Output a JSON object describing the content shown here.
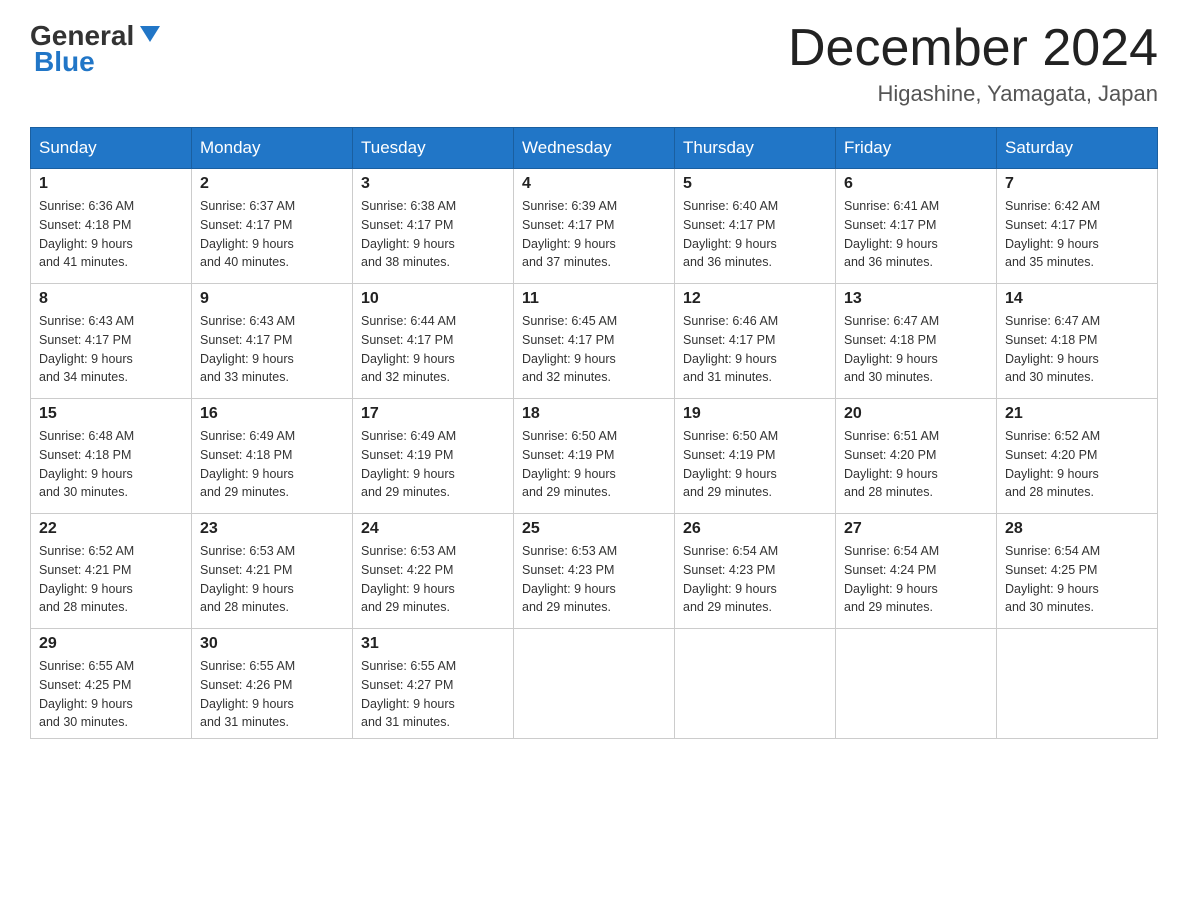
{
  "header": {
    "logo_general": "General",
    "logo_blue": "Blue",
    "month_title": "December 2024",
    "location": "Higashine, Yamagata, Japan"
  },
  "weekdays": [
    "Sunday",
    "Monday",
    "Tuesday",
    "Wednesday",
    "Thursday",
    "Friday",
    "Saturday"
  ],
  "weeks": [
    [
      {
        "day": "1",
        "sunrise": "6:36 AM",
        "sunset": "4:18 PM",
        "daylight": "9 hours and 41 minutes."
      },
      {
        "day": "2",
        "sunrise": "6:37 AM",
        "sunset": "4:17 PM",
        "daylight": "9 hours and 40 minutes."
      },
      {
        "day": "3",
        "sunrise": "6:38 AM",
        "sunset": "4:17 PM",
        "daylight": "9 hours and 38 minutes."
      },
      {
        "day": "4",
        "sunrise": "6:39 AM",
        "sunset": "4:17 PM",
        "daylight": "9 hours and 37 minutes."
      },
      {
        "day": "5",
        "sunrise": "6:40 AM",
        "sunset": "4:17 PM",
        "daylight": "9 hours and 36 minutes."
      },
      {
        "day": "6",
        "sunrise": "6:41 AM",
        "sunset": "4:17 PM",
        "daylight": "9 hours and 36 minutes."
      },
      {
        "day": "7",
        "sunrise": "6:42 AM",
        "sunset": "4:17 PM",
        "daylight": "9 hours and 35 minutes."
      }
    ],
    [
      {
        "day": "8",
        "sunrise": "6:43 AM",
        "sunset": "4:17 PM",
        "daylight": "9 hours and 34 minutes."
      },
      {
        "day": "9",
        "sunrise": "6:43 AM",
        "sunset": "4:17 PM",
        "daylight": "9 hours and 33 minutes."
      },
      {
        "day": "10",
        "sunrise": "6:44 AM",
        "sunset": "4:17 PM",
        "daylight": "9 hours and 32 minutes."
      },
      {
        "day": "11",
        "sunrise": "6:45 AM",
        "sunset": "4:17 PM",
        "daylight": "9 hours and 32 minutes."
      },
      {
        "day": "12",
        "sunrise": "6:46 AM",
        "sunset": "4:17 PM",
        "daylight": "9 hours and 31 minutes."
      },
      {
        "day": "13",
        "sunrise": "6:47 AM",
        "sunset": "4:18 PM",
        "daylight": "9 hours and 30 minutes."
      },
      {
        "day": "14",
        "sunrise": "6:47 AM",
        "sunset": "4:18 PM",
        "daylight": "9 hours and 30 minutes."
      }
    ],
    [
      {
        "day": "15",
        "sunrise": "6:48 AM",
        "sunset": "4:18 PM",
        "daylight": "9 hours and 30 minutes."
      },
      {
        "day": "16",
        "sunrise": "6:49 AM",
        "sunset": "4:18 PM",
        "daylight": "9 hours and 29 minutes."
      },
      {
        "day": "17",
        "sunrise": "6:49 AM",
        "sunset": "4:19 PM",
        "daylight": "9 hours and 29 minutes."
      },
      {
        "day": "18",
        "sunrise": "6:50 AM",
        "sunset": "4:19 PM",
        "daylight": "9 hours and 29 minutes."
      },
      {
        "day": "19",
        "sunrise": "6:50 AM",
        "sunset": "4:19 PM",
        "daylight": "9 hours and 29 minutes."
      },
      {
        "day": "20",
        "sunrise": "6:51 AM",
        "sunset": "4:20 PM",
        "daylight": "9 hours and 28 minutes."
      },
      {
        "day": "21",
        "sunrise": "6:52 AM",
        "sunset": "4:20 PM",
        "daylight": "9 hours and 28 minutes."
      }
    ],
    [
      {
        "day": "22",
        "sunrise": "6:52 AM",
        "sunset": "4:21 PM",
        "daylight": "9 hours and 28 minutes."
      },
      {
        "day": "23",
        "sunrise": "6:53 AM",
        "sunset": "4:21 PM",
        "daylight": "9 hours and 28 minutes."
      },
      {
        "day": "24",
        "sunrise": "6:53 AM",
        "sunset": "4:22 PM",
        "daylight": "9 hours and 29 minutes."
      },
      {
        "day": "25",
        "sunrise": "6:53 AM",
        "sunset": "4:23 PM",
        "daylight": "9 hours and 29 minutes."
      },
      {
        "day": "26",
        "sunrise": "6:54 AM",
        "sunset": "4:23 PM",
        "daylight": "9 hours and 29 minutes."
      },
      {
        "day": "27",
        "sunrise": "6:54 AM",
        "sunset": "4:24 PM",
        "daylight": "9 hours and 29 minutes."
      },
      {
        "day": "28",
        "sunrise": "6:54 AM",
        "sunset": "4:25 PM",
        "daylight": "9 hours and 30 minutes."
      }
    ],
    [
      {
        "day": "29",
        "sunrise": "6:55 AM",
        "sunset": "4:25 PM",
        "daylight": "9 hours and 30 minutes."
      },
      {
        "day": "30",
        "sunrise": "6:55 AM",
        "sunset": "4:26 PM",
        "daylight": "9 hours and 31 minutes."
      },
      {
        "day": "31",
        "sunrise": "6:55 AM",
        "sunset": "4:27 PM",
        "daylight": "9 hours and 31 minutes."
      },
      null,
      null,
      null,
      null
    ]
  ],
  "labels": {
    "sunrise": "Sunrise:",
    "sunset": "Sunset:",
    "daylight": "Daylight:"
  }
}
